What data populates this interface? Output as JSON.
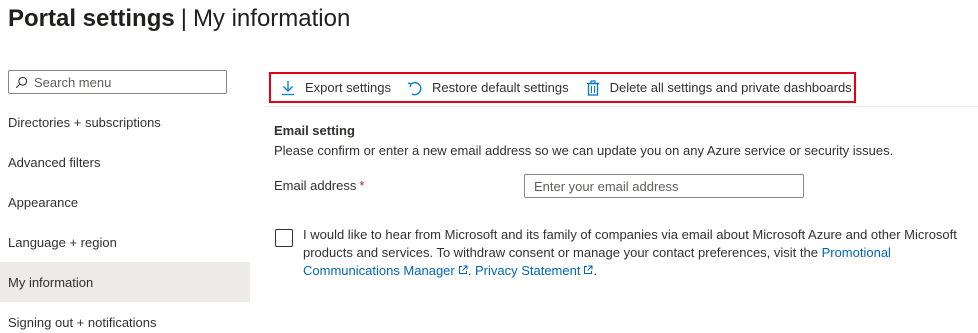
{
  "header": {
    "title": "Portal settings",
    "separator": "|",
    "subtitle": "My information"
  },
  "search": {
    "placeholder": "Search menu",
    "icon": "search-icon"
  },
  "sidebar": {
    "items": [
      {
        "label": "Directories + subscriptions"
      },
      {
        "label": "Advanced filters"
      },
      {
        "label": "Appearance"
      },
      {
        "label": "Language + region"
      },
      {
        "label": "My information",
        "active": true
      },
      {
        "label": "Signing out + notifications"
      }
    ]
  },
  "toolbar": {
    "highlight_color": "#e3001b",
    "export": {
      "label": "Export settings",
      "icon": "download-icon"
    },
    "restore": {
      "label": "Restore default settings",
      "icon": "undo-icon"
    },
    "delete": {
      "label": "Delete all settings and private dashboards",
      "icon": "trash-icon"
    }
  },
  "email_setting": {
    "title": "Email setting",
    "description": "Please confirm or enter a new email address so we can update you on any Azure service or security issues.",
    "field_label": "Email address",
    "required_mark": "*",
    "value": "",
    "placeholder": "Enter your email address"
  },
  "consent": {
    "checked": false,
    "text": "I would like to hear from Microsoft and its family of companies via email about Microsoft Azure and other Microsoft products and services. To withdraw consent or manage your contact preferences, visit the ",
    "link1": "Promotional Communications Manager",
    "between": ". ",
    "link2": "Privacy Statement",
    "end": ".",
    "link_color": "#0067b8"
  }
}
